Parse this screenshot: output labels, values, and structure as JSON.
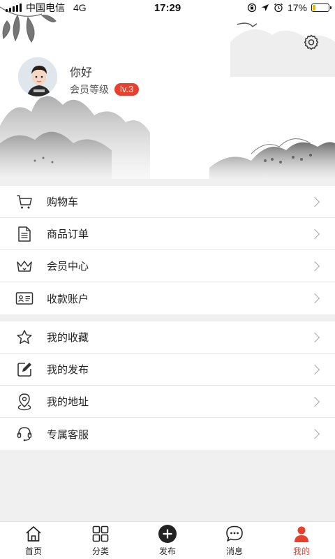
{
  "status_bar": {
    "carrier": "中国电信",
    "network": "4G",
    "time": "17:29",
    "battery": "17%",
    "battery_level": 0.17
  },
  "profile": {
    "greeting": "你好",
    "member_label": "会员等级",
    "level": "lv.3"
  },
  "menu_group_1": [
    {
      "label": "购物车",
      "icon": "cart-icon"
    },
    {
      "label": "商品订单",
      "icon": "order-icon"
    },
    {
      "label": "会员中心",
      "icon": "crown-icon"
    },
    {
      "label": "收款账户",
      "icon": "account-card-icon"
    }
  ],
  "menu_group_2": [
    {
      "label": "我的收藏",
      "icon": "star-icon"
    },
    {
      "label": "我的发布",
      "icon": "edit-icon"
    },
    {
      "label": "我的地址",
      "icon": "location-icon"
    },
    {
      "label": "专属客服",
      "icon": "headset-icon"
    }
  ],
  "tabs": [
    {
      "label": "首页",
      "icon": "home-icon"
    },
    {
      "label": "分类",
      "icon": "grid-icon"
    },
    {
      "label": "发布",
      "icon": "plus-circle-icon"
    },
    {
      "label": "消息",
      "icon": "chat-icon"
    },
    {
      "label": "我的",
      "icon": "user-icon"
    }
  ],
  "colors": {
    "accent": "#e8402f",
    "battery": "#e6b800"
  }
}
